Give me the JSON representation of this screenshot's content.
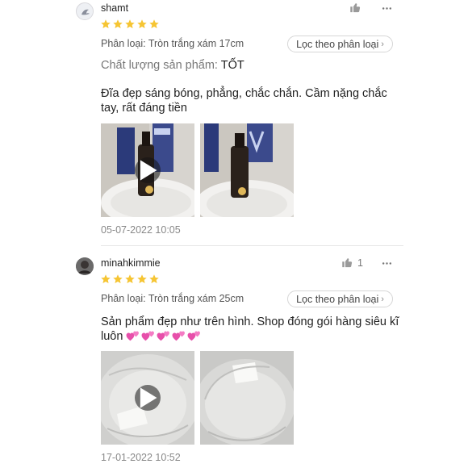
{
  "reviews": [
    {
      "username": "shamt",
      "rating": 5,
      "like_count": "",
      "variation": "Phân loại: Tròn trắng xám 17cm",
      "filter_label": "Lọc theo phân loại",
      "quality_label": "Chất lượng sản phẩm:",
      "quality_value": "TỐT",
      "comment": "Đĩa đẹp sáng bóng, phẳng, chắc chắn. Cầm nặng chắc tay, rất đáng tiền",
      "media": [
        {
          "type": "video",
          "icon": "play-icon"
        },
        {
          "type": "image"
        }
      ],
      "date": "05-07-2022 10:05"
    },
    {
      "username": "minahkimmie",
      "rating": 5,
      "like_count": "1",
      "variation": "Phân loại: Tròn trắng xám 25cm",
      "filter_label": "Lọc theo phân loại",
      "comment": "Sản phẩm đẹp như trên hình. Shop đóng gói hàng siêu kĩ luôn",
      "comment_emoji_count": 5,
      "comment_emoji": "two-hearts-emoji",
      "media": [
        {
          "type": "video",
          "icon": "play-icon"
        },
        {
          "type": "image"
        }
      ],
      "date": "17-01-2022 10:52"
    }
  ],
  "colors": {
    "star": "#f6c533",
    "muted_text": "#888888",
    "heart": "#e74faa"
  }
}
